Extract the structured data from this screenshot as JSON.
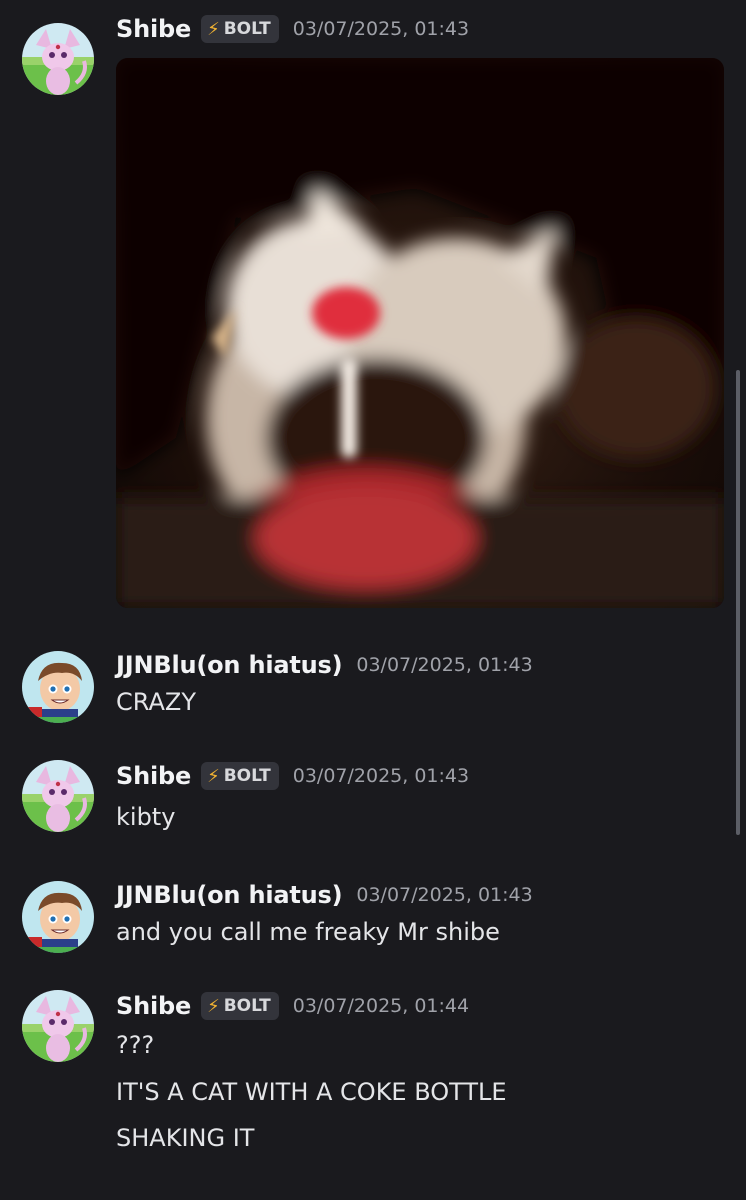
{
  "messages": [
    {
      "username": "Shibe",
      "badge": "BOLT",
      "badge_icon": "lightning-bolt-icon",
      "timestamp": "03/07/2025, 01:43",
      "attachment": "gif-image"
    },
    {
      "username": "JJNBlu(on hiatus)",
      "timestamp": "03/07/2025, 01:43",
      "lines": [
        "CRAZY"
      ]
    },
    {
      "username": "Shibe",
      "badge": "BOLT",
      "badge_icon": "lightning-bolt-icon",
      "timestamp": "03/07/2025, 01:43",
      "lines": [
        "kibty"
      ]
    },
    {
      "username": "JJNBlu(on hiatus)",
      "timestamp": "03/07/2025, 01:43",
      "lines": [
        "and you call me freaky Mr shibe"
      ]
    },
    {
      "username": "Shibe",
      "badge": "BOLT",
      "badge_icon": "lightning-bolt-icon",
      "timestamp": "03/07/2025, 01:44",
      "lines": [
        "???",
        "IT'S A CAT WITH A COKE BOTTLE",
        "SHAKING IT"
      ]
    }
  ],
  "colors": {
    "background": "#1a1a1e",
    "username": "#f2f3f5",
    "timestamp": "#a0a2a9",
    "message_text": "#e4e5e8",
    "badge_bg": "#33343b",
    "bolt": "#f0b232"
  }
}
